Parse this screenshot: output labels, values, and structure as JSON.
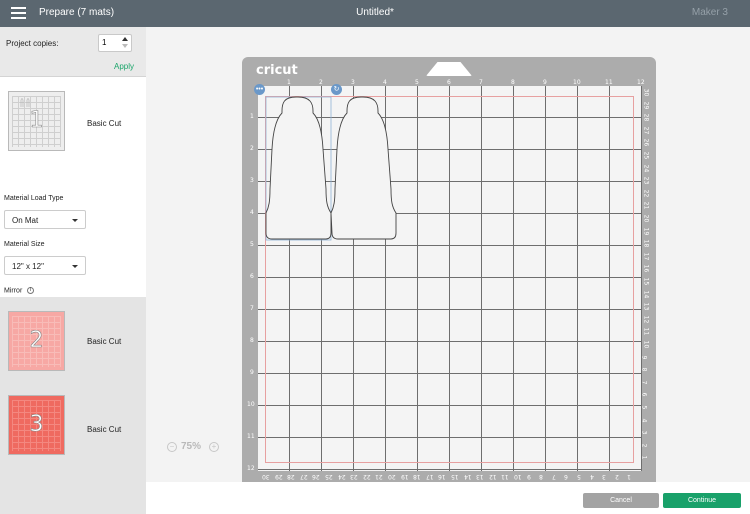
{
  "header": {
    "title": "Prepare (7 mats)",
    "doc_title": "Untitled*",
    "machine": "Maker 3"
  },
  "copies": {
    "label": "Project copies:",
    "value": "1",
    "apply_label": "Apply"
  },
  "mats": [
    {
      "number": "1",
      "label": "Basic Cut"
    },
    {
      "number": "2",
      "label": "Basic Cut"
    },
    {
      "number": "3",
      "label": "Basic Cut"
    }
  ],
  "settings": {
    "load_type_label": "Material Load Type",
    "load_type_value": "On Mat",
    "size_label": "Material Size",
    "size_value": "12\" x 12\"",
    "mirror_label": "Mirror",
    "mirror_on": false
  },
  "mat_canvas": {
    "brand": "cricut",
    "top_ticks": [
      "1",
      "2",
      "3",
      "4",
      "5",
      "6",
      "7",
      "8",
      "9",
      "10",
      "11",
      "12"
    ],
    "left_ticks": [
      "1",
      "2",
      "3",
      "4",
      "5",
      "6",
      "7",
      "8",
      "9",
      "10",
      "11",
      "12"
    ],
    "bottom_ticks": [
      "30",
      "29",
      "28",
      "27",
      "26",
      "25",
      "24",
      "23",
      "22",
      "21",
      "20",
      "19",
      "18",
      "17",
      "16",
      "15",
      "14",
      "13",
      "12",
      "11",
      "10",
      "9",
      "8",
      "7",
      "6",
      "5",
      "4",
      "3",
      "2",
      "1"
    ],
    "right_ticks": [
      "30",
      "29",
      "28",
      "27",
      "26",
      "25",
      "24",
      "23",
      "22",
      "21",
      "20",
      "19",
      "18",
      "17",
      "16",
      "15",
      "14",
      "13",
      "12",
      "11",
      "10",
      "9",
      "8",
      "7",
      "6",
      "5",
      "4",
      "3",
      "2",
      "1"
    ],
    "menu_handle": "•••"
  },
  "zoom": {
    "minus": "−",
    "value": "75%",
    "plus": "+"
  },
  "footer": {
    "cancel_label": "Cancel",
    "continue_label": "Continue"
  },
  "colors": {
    "accent": "#19a16a",
    "topbar": "#5b6770",
    "mat2": "#f7a8a4",
    "mat3": "#ef6a60",
    "selection": "#6a98c9"
  },
  "icons": [
    "hamburger-icon",
    "info-icon",
    "rotate-icon",
    "menu-dots-icon",
    "zoom-out-icon",
    "zoom-in-icon"
  ]
}
